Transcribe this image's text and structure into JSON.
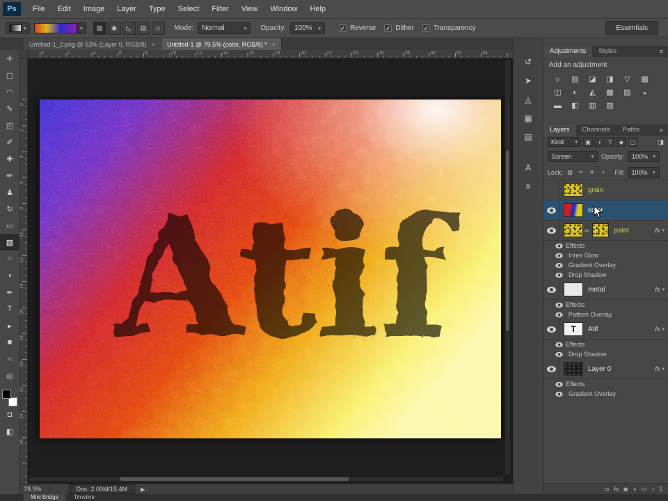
{
  "app": {
    "logo_text": "Ps"
  },
  "glyphs": {
    "caret": "▾",
    "check": "✓",
    "play": "▶",
    "menu": "≡",
    "link": "∞",
    "text_thumb": "T"
  },
  "menu_bar": {
    "items": [
      "File",
      "Edit",
      "Image",
      "Layer",
      "Type",
      "Select",
      "Filter",
      "View",
      "Window",
      "Help"
    ]
  },
  "options_bar": {
    "gradient_types": [
      {
        "name": "linear-gradient-button",
        "glyph": "▧",
        "selected": true
      },
      {
        "name": "radial-gradient-button",
        "glyph": "◉",
        "selected": false
      },
      {
        "name": "angle-gradient-button",
        "glyph": "◺",
        "selected": false
      },
      {
        "name": "reflected-gradient-button",
        "glyph": "▤",
        "selected": false
      },
      {
        "name": "diamond-gradient-button",
        "glyph": "◇",
        "selected": false
      }
    ],
    "mode_label": "Mode:",
    "mode_value": "Normal",
    "opacity_label": "Opacity:",
    "opacity_value": "100%",
    "checkboxes": [
      {
        "name": "reverse-checkbox",
        "label": "Reverse",
        "checked": true
      },
      {
        "name": "dither-checkbox",
        "label": "Dither",
        "checked": true
      },
      {
        "name": "transparency-checkbox",
        "label": "Transparency",
        "checked": true
      }
    ],
    "workspace_button": "Essentials",
    "gradient_preview_colors": [
      "#d0431c",
      "#e0b61e",
      "#2d2dc8",
      "#8c22b4"
    ]
  },
  "document_tabs": [
    {
      "label": "Untitled-1_2.png @ 53% (Layer 0, RGB/8)",
      "close": "×",
      "active": false
    },
    {
      "label": "Untitled-1 @ 79.5% (color, RGB/8) *",
      "close": "×",
      "active": true
    }
  ],
  "tool_palette": [
    {
      "name": "move-tool",
      "glyph": "✛",
      "selected": false
    },
    {
      "name": "marquee-tool",
      "glyph": "▢",
      "selected": false
    },
    {
      "name": "lasso-tool",
      "glyph": "◠",
      "selected": false
    },
    {
      "name": "quick-selection-tool",
      "glyph": "✎",
      "selected": false
    },
    {
      "name": "crop-tool",
      "glyph": "◰",
      "selected": false
    },
    {
      "name": "eyedropper-tool",
      "glyph": "✐",
      "selected": false
    },
    {
      "name": "healing-brush-tool",
      "glyph": "✚",
      "selected": false
    },
    {
      "name": "brush-tool",
      "glyph": "✏",
      "selected": false
    },
    {
      "name": "clone-stamp-tool",
      "glyph": "♟",
      "selected": false
    },
    {
      "name": "history-brush-tool",
      "glyph": "↻",
      "selected": false
    },
    {
      "name": "eraser-tool",
      "glyph": "▭",
      "selected": false
    },
    {
      "name": "gradient-tool",
      "glyph": "▧",
      "selected": true
    },
    {
      "name": "blur-tool",
      "glyph": "○",
      "selected": false
    },
    {
      "name": "dodge-tool",
      "glyph": "◖",
      "selected": false
    },
    {
      "name": "pen-tool",
      "glyph": "✒",
      "selected": false
    },
    {
      "name": "type-tool",
      "glyph": "T",
      "selected": false
    },
    {
      "name": "path-selection-tool",
      "glyph": "▸",
      "selected": false
    },
    {
      "name": "shape-tool",
      "glyph": "■",
      "selected": false
    },
    {
      "name": "hand-tool",
      "glyph": "☜",
      "selected": false
    },
    {
      "name": "zoom-tool",
      "glyph": "◎",
      "selected": false
    }
  ],
  "toolbar_extra": [
    {
      "name": "quick-mask-button",
      "glyph": "◘"
    },
    {
      "name": "screen-mode-button",
      "glyph": "◧"
    }
  ],
  "rulers": {
    "horizontal": [
      "0",
      "2",
      "4",
      "6",
      "8",
      "10",
      "12",
      "14",
      "16",
      "18",
      "20",
      "22",
      "24",
      "26",
      "28",
      "30",
      "32",
      "34"
    ],
    "vertical": [
      "0",
      "2",
      "4",
      "6",
      "8",
      "10",
      "12",
      "14",
      "16",
      "18",
      "20",
      "22",
      "24",
      "26"
    ]
  },
  "canvas": {
    "text": "Atif",
    "gradient_colors": [
      "#3c2fd4",
      "#cf2428",
      "#f0a619",
      "#f9f06a"
    ]
  },
  "status_bar": {
    "zoom": "79.5%",
    "doc_info": "Doc: 2.00M/15.4M"
  },
  "bottom_bar": {
    "tabs": [
      "Mini Bridge",
      "Timeline"
    ]
  },
  "dock_strip": {
    "group1": [
      {
        "name": "history-panel-icon",
        "glyph": "↺"
      },
      {
        "name": "navigator-panel-icon",
        "glyph": "➤"
      },
      {
        "name": "info-panel-icon",
        "glyph": "◬"
      },
      {
        "name": "color-panel-icon",
        "glyph": "▦"
      },
      {
        "name": "swatches-panel-icon",
        "glyph": "▤"
      }
    ],
    "group2": [
      {
        "name": "character-panel-icon",
        "glyph": "A"
      },
      {
        "name": "paragraph-panel-icon",
        "glyph": "≡"
      }
    ]
  },
  "adjustments_panel": {
    "tabs": [
      {
        "label": "Adjustments",
        "active": true
      },
      {
        "label": "Styles",
        "active": false
      }
    ],
    "subtitle": "Add an adjustment",
    "icons": [
      {
        "name": "brightness-contrast-adjustment-icon",
        "glyph": "☼"
      },
      {
        "name": "levels-adjustment-icon",
        "glyph": "▤"
      },
      {
        "name": "curves-adjustment-icon",
        "glyph": "◪"
      },
      {
        "name": "exposure-adjustment-icon",
        "glyph": "◨"
      },
      {
        "name": "vibrance-adjustment-icon",
        "glyph": "▽"
      },
      {
        "name": "hue-saturation-adjustment-icon",
        "glyph": "▦"
      },
      {
        "name": "color-balance-adjustment-icon",
        "glyph": "◫"
      },
      {
        "name": "black-white-adjustment-icon",
        "glyph": "◐"
      },
      {
        "name": "photo-filter-adjustment-icon",
        "glyph": "◭"
      },
      {
        "name": "channel-mixer-adjustment-icon",
        "glyph": "▩"
      },
      {
        "name": "color-lookup-adjustment-icon",
        "glyph": "▨"
      },
      {
        "name": "invert-adjustment-icon",
        "glyph": "◒"
      },
      {
        "name": "posterize-adjustment-icon",
        "glyph": "▬"
      },
      {
        "name": "threshold-adjustment-icon",
        "glyph": "◧"
      },
      {
        "name": "gradient-map-adjustment-icon",
        "glyph": "▥"
      },
      {
        "name": "selective-color-adjustment-icon",
        "glyph": "▧"
      }
    ]
  },
  "layers_panel": {
    "tabs": [
      {
        "label": "Layers",
        "active": true
      },
      {
        "label": "Channels",
        "active": false
      },
      {
        "label": "Paths",
        "active": false
      }
    ],
    "kind_label": "Kind",
    "filter_icons": [
      {
        "name": "filter-pixel-layers-icon",
        "glyph": "▣"
      },
      {
        "name": "filter-adjustment-layers-icon",
        "glyph": "◑"
      },
      {
        "name": "filter-type-layers-icon",
        "glyph": "T"
      },
      {
        "name": "filter-shape-layers-icon",
        "glyph": "◆"
      },
      {
        "name": "filter-smart-objects-icon",
        "glyph": "▢"
      }
    ],
    "filter_toggle": {
      "name": "layer-filter-toggle-icon",
      "glyph": "◨"
    },
    "blend_mode": "Screen",
    "opacity_label": "Opacity:",
    "opacity_value": "100%",
    "lock_label": "Lock:",
    "lock_icons": [
      {
        "name": "lock-transparent-pixels-icon",
        "glyph": "▨"
      },
      {
        "name": "lock-image-pixels-icon",
        "glyph": "✑"
      },
      {
        "name": "lock-position-icon",
        "glyph": "✛"
      },
      {
        "name": "lock-all-icon",
        "glyph": "▪"
      }
    ],
    "fill_label": "Fill:",
    "fill_value": "100%",
    "fx_label": "fx",
    "items": [
      {
        "type": "layer",
        "layer_name": "grain",
        "thumb": "noise",
        "eye": false,
        "selected": false,
        "fx": false,
        "name_color": "#c6d063"
      },
      {
        "type": "layer",
        "layer_name": "color",
        "thumb": "gradient",
        "eye": true,
        "selected": true,
        "fx": false
      },
      {
        "type": "layer",
        "layer_name": "paint",
        "thumb": "noise",
        "thumb2": "noise",
        "eye": true,
        "selected": false,
        "fx": true,
        "name_color": "#c6d063"
      },
      {
        "type": "effects",
        "label": "Effects"
      },
      {
        "type": "effect",
        "label": "Inner Glow"
      },
      {
        "type": "effect",
        "label": "Gradient Overlay"
      },
      {
        "type": "effect",
        "label": "Drop Shadow"
      },
      {
        "type": "layer",
        "layer_name": "metal",
        "thumb": "white",
        "eye": true,
        "selected": false,
        "fx": true
      },
      {
        "type": "effects",
        "label": "Effects"
      },
      {
        "type": "effect",
        "label": "Pattern Overlay"
      },
      {
        "type": "layer",
        "layer_name": "Atif",
        "thumb": "text",
        "eye": true,
        "selected": false,
        "fx": true
      },
      {
        "type": "effects",
        "label": "Effects"
      },
      {
        "type": "effect",
        "label": "Drop Shadow"
      },
      {
        "type": "layer",
        "layer_name": "Layer 0",
        "thumb": "dark",
        "eye": true,
        "selected": false,
        "fx": true
      },
      {
        "type": "effects",
        "label": "Effects"
      },
      {
        "type": "effect",
        "label": "Gradient Overlay"
      }
    ],
    "footer_icons": [
      {
        "name": "link-layers-icon",
        "glyph": "∞"
      },
      {
        "name": "layer-style-icon",
        "glyph": "fx"
      },
      {
        "name": "add-layer-mask-icon",
        "glyph": "◙"
      },
      {
        "name": "new-adjustment-layer-icon",
        "glyph": "◑"
      },
      {
        "name": "new-group-icon",
        "glyph": "▭"
      },
      {
        "name": "new-layer-icon",
        "glyph": "▫"
      },
      {
        "name": "delete-layer-icon",
        "glyph": "▯"
      }
    ]
  }
}
